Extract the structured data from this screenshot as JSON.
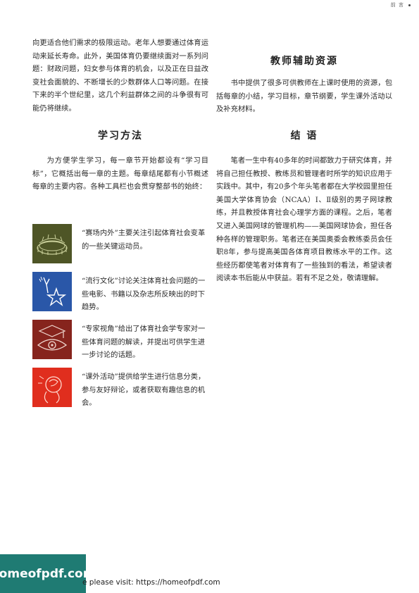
{
  "header": {
    "mark": "前 言"
  },
  "left": {
    "intro": "向更适合他们需求的极限运动。老年人想要通过体育运动来延长寿命。此外，美国体育仍要继续面对一系列问题：财政问题，妇女参与体育的机会，以及正在日益改变社会面貌的、不断增长的少数群体人口等问题。在接下来的半个世纪里，这几个利益群体之间的斗争很有可能仍将继续。",
    "methods_heading": "学习方法",
    "methods_body": "为方便学生学习，每一章节开始都设有“学习目标”，它概括出每一章的主题。每章结尾都有小节概述每章的主要内容。各种工具栏也会贯穿整部书的始终：",
    "tools": [
      {
        "icon": "stadium-icon",
        "text": "“赛场内外”主要关注引起体育社会变革的一些关键运动员。",
        "color": "#4e5526"
      },
      {
        "icon": "statue-of-liberty-icon",
        "text": "“流行文化”讨论关注体育社会问题的一些电影、书籍以及杂志所反映出的时下趋势。",
        "color": "#2a57a8"
      },
      {
        "icon": "graduation-eye-icon",
        "text": "“专家视角”给出了体育社会学专家对一些体育问题的解读，并提出可供学生进一步讨论的话题。",
        "color": "#86241d"
      },
      {
        "icon": "activity-icon",
        "text": "“课外活动”提供给学生进行信息分类，参与友好辩论，或者获取有趣信息的机会。",
        "color": "#e02e1e"
      }
    ]
  },
  "right": {
    "resources_heading": "教师辅助资源",
    "resources_body": "书中提供了很多可供教师在上课时使用的资源，包括每章的小结，学习目标，章节纲要，学生课外活动以及补充材料。",
    "conclusion_heading": "结 语",
    "conclusion_body": "笔者一生中有40多年的时间都致力于研究体育，并将自己担任教授、教练员和管理者时所学的知识应用于实践中。其中，有20多个年头笔者都在大学校园里担任美国大学体育协会（NCAA）Ⅰ、Ⅱ级别的男子网球教练，并且教授体育社会心理学方面的课程。之后，笔者又进入美国网球的管理机构——美国网球协会，担任各种各样的管理职务。笔者还在美国奥委会教练委员会任职8年，参与提高美国各体育项目教练水平的工作。这些经历都使笔者对体育有了一些独到的看法，希望读者阅读本书后能从中获益。若有不足之处，敬请理解。"
  },
  "footer": {
    "banner": "homeofpdf.com",
    "visit_text": "e please visit: https://homeofpdf.com"
  }
}
